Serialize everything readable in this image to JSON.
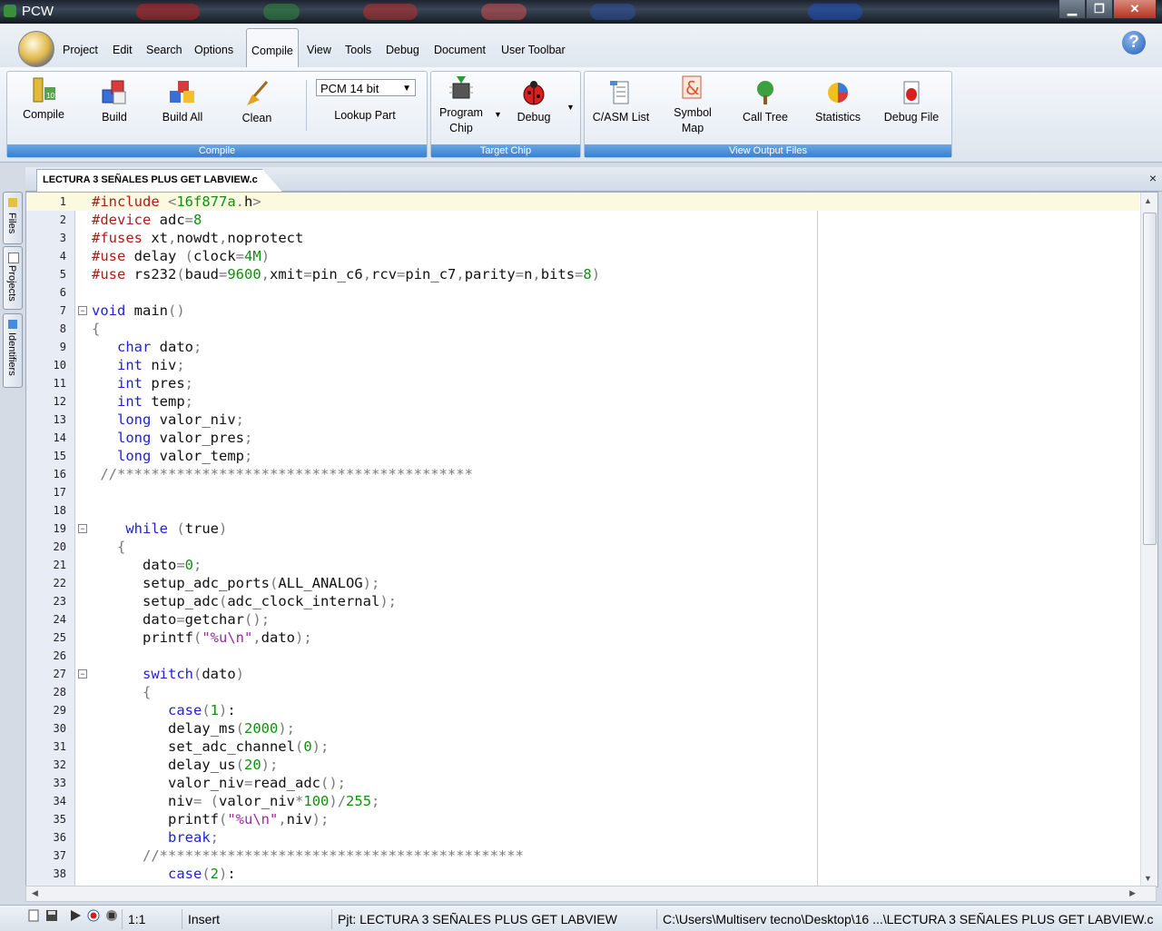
{
  "window": {
    "title": "PCW",
    "minimize": "▁",
    "maximize": "❐",
    "close": "✕"
  },
  "menu": {
    "items": [
      "Project",
      "Edit",
      "Search",
      "Options",
      "Compile",
      "View",
      "Tools",
      "Debug",
      "Document",
      "User Toolbar"
    ],
    "active": "Compile",
    "help": "?"
  },
  "ribbon": {
    "groups": [
      {
        "label": "Compile",
        "buttons": [
          "Compile",
          "Build",
          "Build All",
          "Clean"
        ],
        "select_value": "PCM 14 bit",
        "lookup": "Lookup Part"
      },
      {
        "label": "Target Chip",
        "buttons": [
          "Program Chip",
          "Debug"
        ]
      },
      {
        "label": "View Output Files",
        "buttons": [
          "C/ASM List",
          "Symbol Map",
          "Call Tree",
          "Statistics",
          "Debug File"
        ]
      }
    ]
  },
  "tab": {
    "label": "LECTURA 3 SEÑALES PLUS GET LABVIEW.c",
    "close": "×"
  },
  "sidebar": {
    "tabs": [
      "Files",
      "Projects",
      "Identifiers"
    ]
  },
  "editor": {
    "current_line": 1,
    "lines": [
      "#include <16f877a.h>",
      "#device adc=8",
      "#fuses xt,nowdt,noprotect",
      "#use delay (clock=4M)",
      "#use rs232(baud=9600,xmit=pin_c6,rcv=pin_c7,parity=n,bits=8)",
      "",
      "void main()",
      "{",
      "   char dato;",
      "   int niv;",
      "   int pres;",
      "   int temp;",
      "   long valor_niv;",
      "   long valor_pres;",
      "   long valor_temp;",
      " //******************************************",
      "",
      "",
      "    while (true)",
      "   {",
      "      dato=0;",
      "      setup_adc_ports(ALL_ANALOG);",
      "      setup_adc(adc_clock_internal);",
      "      dato=getchar();",
      "      printf(\"%u\\n\",dato);",
      "",
      "      switch(dato)",
      "      {",
      "         case(1):",
      "         delay_ms(2000);",
      "         set_adc_channel(0);",
      "         delay_us(20);",
      "         valor_niv=read_adc();",
      "         niv= (valor_niv*100)/255;",
      "         printf(\"%u\\n\",niv);",
      "         break;",
      "      //*******************************************",
      "         case(2):"
    ],
    "fold_lines": [
      7,
      19,
      27
    ]
  },
  "status": {
    "position": "1:1",
    "mode": "Insert",
    "project": "Pjt: LECTURA 3 SEÑALES PLUS GET LABVIEW",
    "path": "C:\\Users\\Multiserv tecno\\Desktop\\16 ...\\LECTURA 3 SEÑALES PLUS GET LABVIEW.c"
  },
  "colors": {
    "keyword": "#1f1fd8",
    "preprocessor": "#b01a1a",
    "number": "#109010",
    "string": "#9a2aa0",
    "ribbon_label": "#3b80cf"
  }
}
